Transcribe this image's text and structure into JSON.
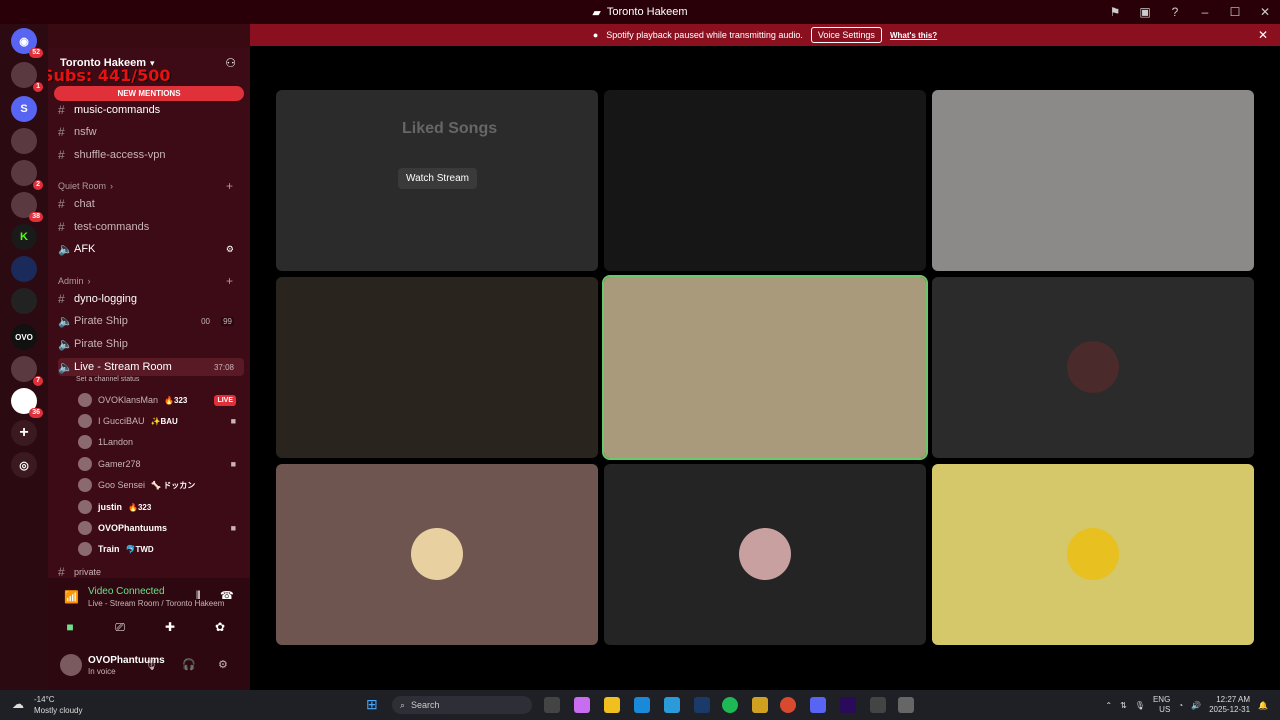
{
  "window": {
    "title": "Toronto Hakeem"
  },
  "rail": {
    "badges": [
      "52",
      "1",
      "2",
      "38",
      "7",
      "36"
    ]
  },
  "guild": {
    "name": "Toronto Hakeem",
    "overlay": "Subs: 441/500",
    "new_mentions": "NEW MENTIONS"
  },
  "channels": [
    {
      "name": "music-commands",
      "bold": true
    },
    {
      "name": "nsfw"
    },
    {
      "name": "shuffle-access-vpn"
    }
  ],
  "quiet_room": {
    "label": "Quiet Room",
    "channels": [
      "chat",
      "test-commands"
    ],
    "voice": "AFK"
  },
  "admin": {
    "label": "Admin",
    "text_channel": "dyno-logging",
    "voice_1": "Pirate Ship",
    "voice_1_counts": [
      "00",
      "99"
    ],
    "voice_2": "Pirate Ship",
    "live_room": "Live - Stream Room",
    "live_timer": "37:08",
    "live_status": "Set a channel status",
    "private_hint": "private"
  },
  "members": [
    {
      "name": "OVOKlansMan",
      "tag": "🔥323",
      "live": "LIVE"
    },
    {
      "name": "I GucciBAU",
      "tag": "✨BAU"
    },
    {
      "name": "1Landon",
      "tag": ""
    },
    {
      "name": "Gamer278",
      "tag": ""
    },
    {
      "name": "Goo Sensei",
      "tag": "🦴 ドッカン"
    },
    {
      "name": "justin",
      "tag": "🔥323"
    },
    {
      "name": "OVOPhantuums",
      "tag": ""
    },
    {
      "name": "Train",
      "tag": "🐬TWD"
    }
  ],
  "voice_panel": {
    "status": "Video Connected",
    "location": "Live - Stream Room / Toronto Hakeem",
    "user": "OVOPhantuums",
    "user_status": "In voice"
  },
  "notice": {
    "text": "Spotify playback paused while transmitting audio.",
    "button": "Voice Settings",
    "link": "What's this?"
  },
  "tiles": {
    "watch_stream": "Watch Stream",
    "stream_preview_text": "Liked Songs"
  },
  "taskbar": {
    "weather_temp": "-14°C",
    "weather_desc": "Mostly cloudy",
    "search": "Search",
    "lang": "ENG",
    "region": "US",
    "time": "12:27 AM",
    "date": "2025-12-31"
  },
  "colors": {
    "accent": "#e0303a",
    "speaking": "#6ac86a",
    "sidebar": "#3c0b15",
    "banner": "#8a1020"
  }
}
